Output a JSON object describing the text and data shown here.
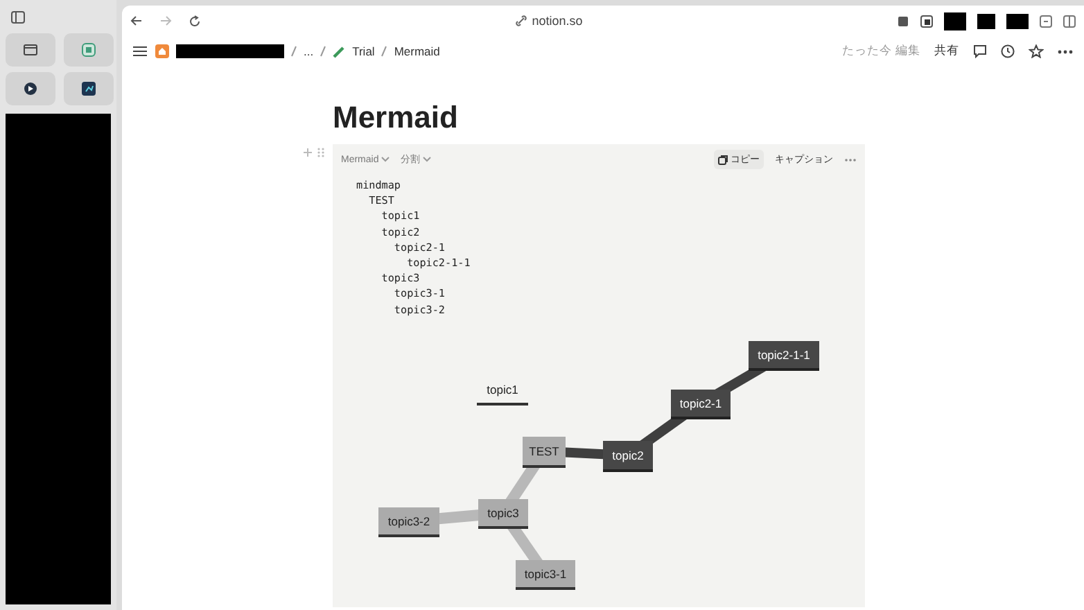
{
  "browser": {
    "url": "notion.so"
  },
  "breadcrumb": {
    "items": [
      "...",
      "Trial",
      "Mermaid"
    ]
  },
  "header": {
    "edited": "たった今 編集",
    "share": "共有"
  },
  "page": {
    "title": "Mermaid"
  },
  "code_block": {
    "language": "Mermaid",
    "view": "分割",
    "copy": "コピー",
    "caption": "キャプション",
    "code_lines": [
      "mindmap",
      "  TEST",
      "    topic1",
      "    topic2",
      "      topic2-1",
      "        topic2-1-1",
      "    topic3",
      "      topic3-1",
      "      topic3-2"
    ]
  },
  "mindmap": {
    "root": {
      "label": "TEST",
      "kind": "light",
      "children": [
        {
          "label": "topic1",
          "kind": "plain"
        },
        {
          "label": "topic2",
          "kind": "dark",
          "children": [
            {
              "label": "topic2-1",
              "kind": "dark",
              "children": [
                {
                  "label": "topic2-1-1",
                  "kind": "dark"
                }
              ]
            }
          ]
        },
        {
          "label": "topic3",
          "kind": "light",
          "children": [
            {
              "label": "topic3-1",
              "kind": "light"
            },
            {
              "label": "topic3-2",
              "kind": "light"
            }
          ]
        }
      ]
    }
  }
}
